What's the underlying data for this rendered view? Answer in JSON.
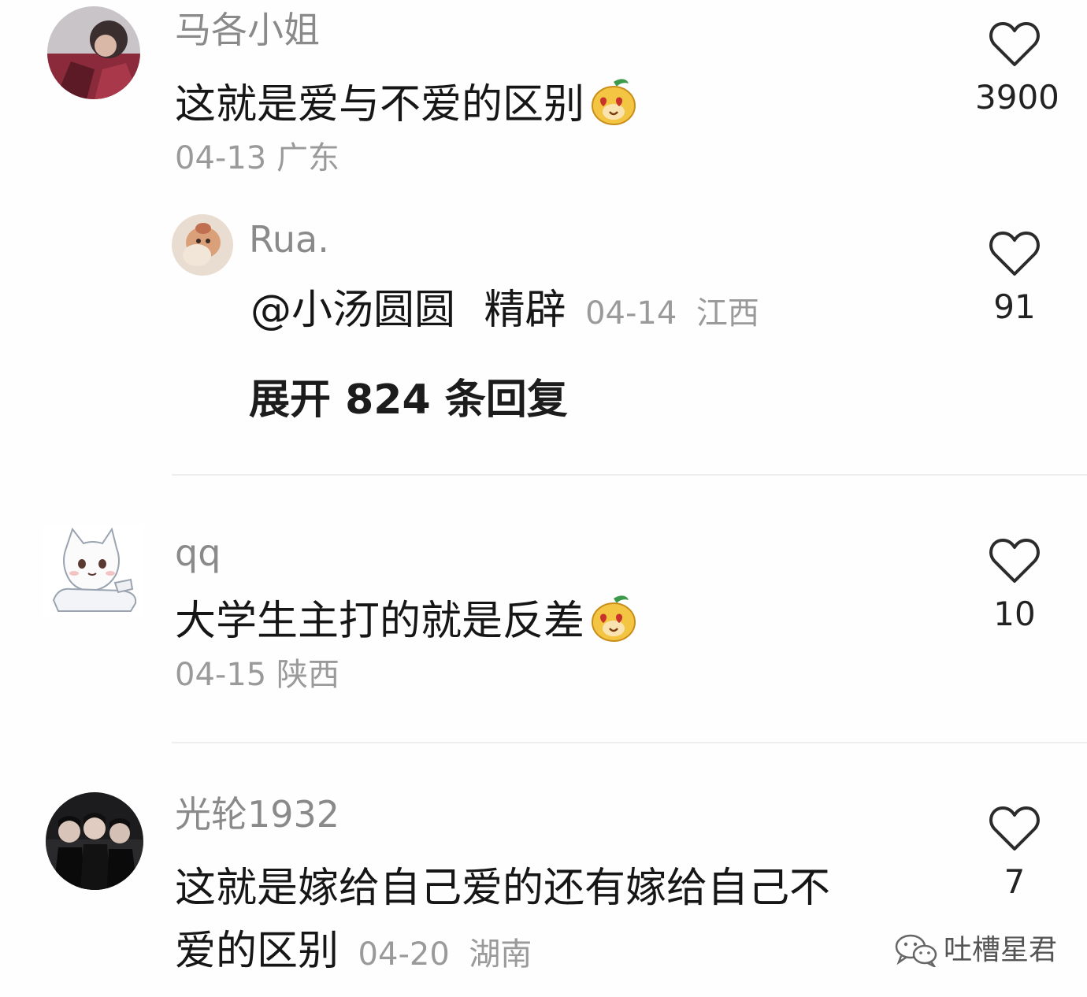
{
  "comments": [
    {
      "user": "马各小姐",
      "text": "这就是爱与不爱的区别",
      "emoji": "heart-eyes-mango-icon",
      "date": "04-13",
      "location": "广东",
      "likes": "3900",
      "reply": {
        "user": "Rua.",
        "mention": "@小汤圆圆",
        "text": "精辟",
        "date": "04-14",
        "location": "江西",
        "likes": "91"
      },
      "expand_label": "展开 824 条回复"
    },
    {
      "user": "qq",
      "text": "大学生主打的就是反差",
      "emoji": "heart-eyes-mango-icon",
      "date": "04-15",
      "location": "陕西",
      "likes": "10"
    },
    {
      "user": "光轮1932",
      "text_line1": "这就是嫁给自己爱的还有嫁给自己不",
      "text_line2": "爱的区别",
      "date": "04-20",
      "location": "湖南",
      "likes": "7"
    }
  ],
  "watermark": {
    "text": "吐槽星君",
    "icon": "wechat-icon"
  },
  "colors": {
    "username": "#8a8a8a",
    "body_text": "#161616",
    "meta": "#9a9a9a",
    "divider": "#eeeeee"
  }
}
